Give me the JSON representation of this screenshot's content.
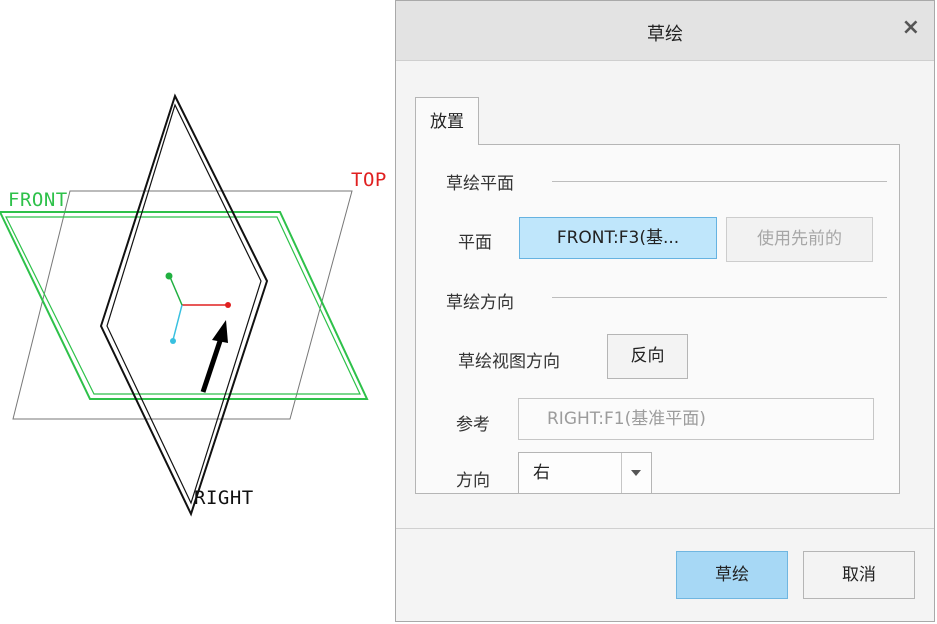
{
  "viewport": {
    "labels": {
      "front": "FRONT",
      "top": "TOP",
      "right": "RIGHT"
    },
    "colors": {
      "front_plane": "#2ec14a",
      "top_label": "#e02020",
      "right_plane": "#111111",
      "top_plane": "#777777",
      "csys_x": "#e02020",
      "csys_y": "#20b040",
      "csys_z": "#38c0e0"
    }
  },
  "dialog": {
    "title": "草绘",
    "close_icon": "close-icon",
    "tab_label": "放置",
    "sketch_plane": {
      "section_label": "草绘平面",
      "plane_label": "平面",
      "plane_value": "FRONT:F3(基...",
      "use_previous_label": "使用先前的"
    },
    "sketch_orientation": {
      "section_label": "草绘方向",
      "view_dir_label": "草绘视图方向",
      "flip_label": "反向",
      "reference_label": "参考",
      "reference_value": "RIGHT:F1(基准平面)",
      "direction_label": "方向",
      "direction_value": "右"
    },
    "footer": {
      "sketch_button": "草绘",
      "cancel_button": "取消"
    }
  }
}
